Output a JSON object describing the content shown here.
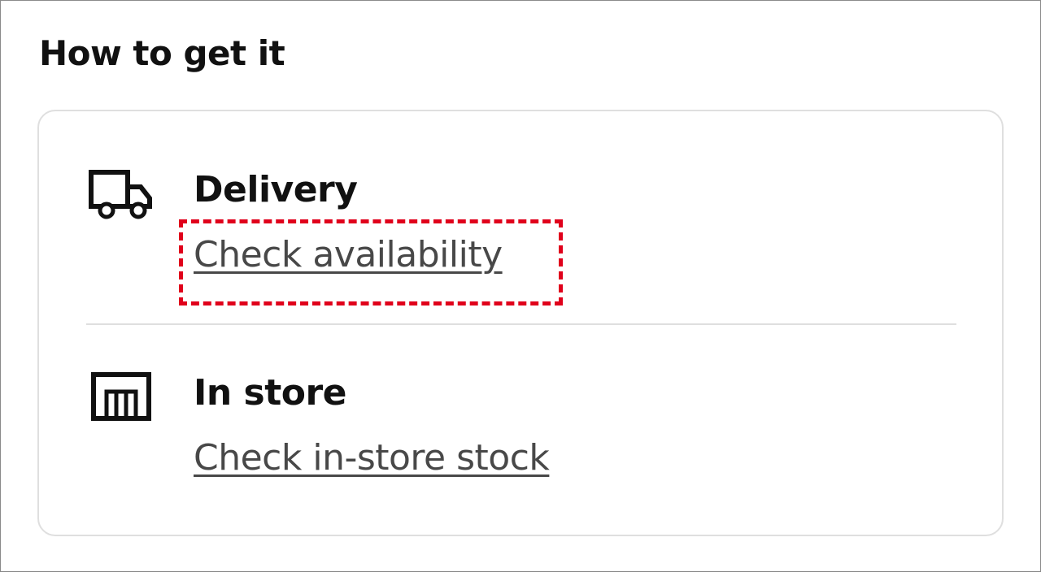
{
  "section": {
    "title": "How to get it"
  },
  "delivery": {
    "title": "Delivery",
    "link_label": "Check availability",
    "icon": "truck-icon"
  },
  "in_store": {
    "title": "In store",
    "link_label": "Check in-store stock",
    "icon": "store-icon"
  },
  "colors": {
    "highlight": "#e0001b",
    "link_text": "#484848",
    "border": "#dfdfdf"
  }
}
